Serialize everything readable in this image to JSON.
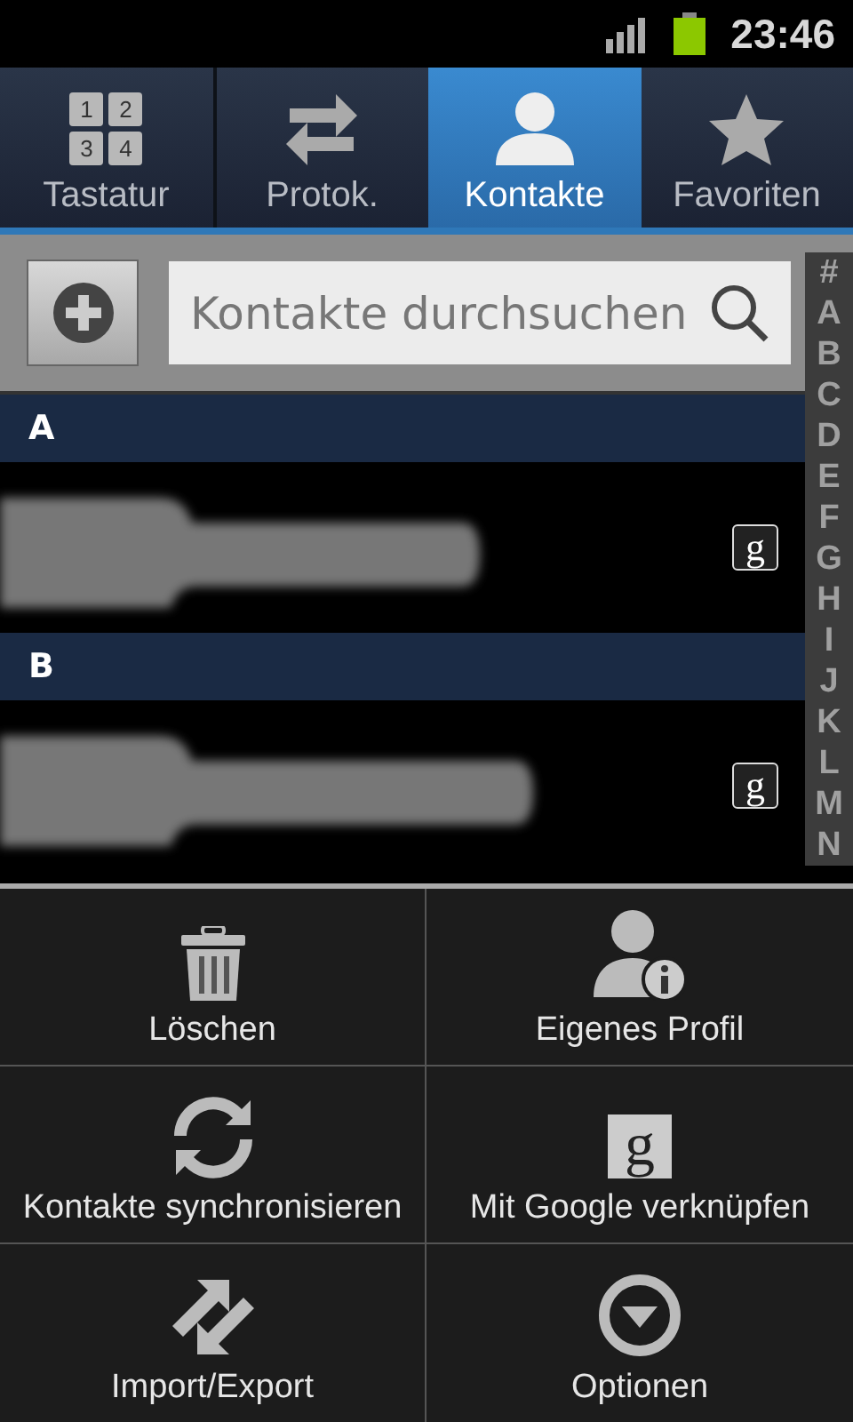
{
  "status_bar": {
    "time": "23:46"
  },
  "tabs": [
    {
      "label": "Tastatur",
      "icon_digits": [
        "1",
        "2",
        "3",
        "4"
      ],
      "selected": false
    },
    {
      "label": "Protok.",
      "selected": false
    },
    {
      "label": "Kontakte",
      "selected": true
    },
    {
      "label": "Favoriten",
      "selected": false
    }
  ],
  "search": {
    "placeholder": "Kontakte durchsuchen"
  },
  "index_letters": [
    "#",
    "A",
    "B",
    "C",
    "D",
    "E",
    "F",
    "G",
    "H",
    "I",
    "J",
    "K",
    "L",
    "M",
    "N"
  ],
  "sections": [
    {
      "letter": "A",
      "contacts": [
        {
          "kind": "redacted",
          "badge": "g"
        }
      ]
    },
    {
      "letter": "B",
      "contacts": [
        {
          "kind": "redacted",
          "badge": "g"
        }
      ]
    }
  ],
  "menu": [
    {
      "label": "Löschen"
    },
    {
      "label": "Eigenes Profil"
    },
    {
      "label": "Kontakte synchronisieren"
    },
    {
      "label": "Mit Google verknüpfen"
    },
    {
      "label": "Import/Export"
    },
    {
      "label": "Optionen"
    }
  ],
  "google_menu_icon_letter": "g"
}
